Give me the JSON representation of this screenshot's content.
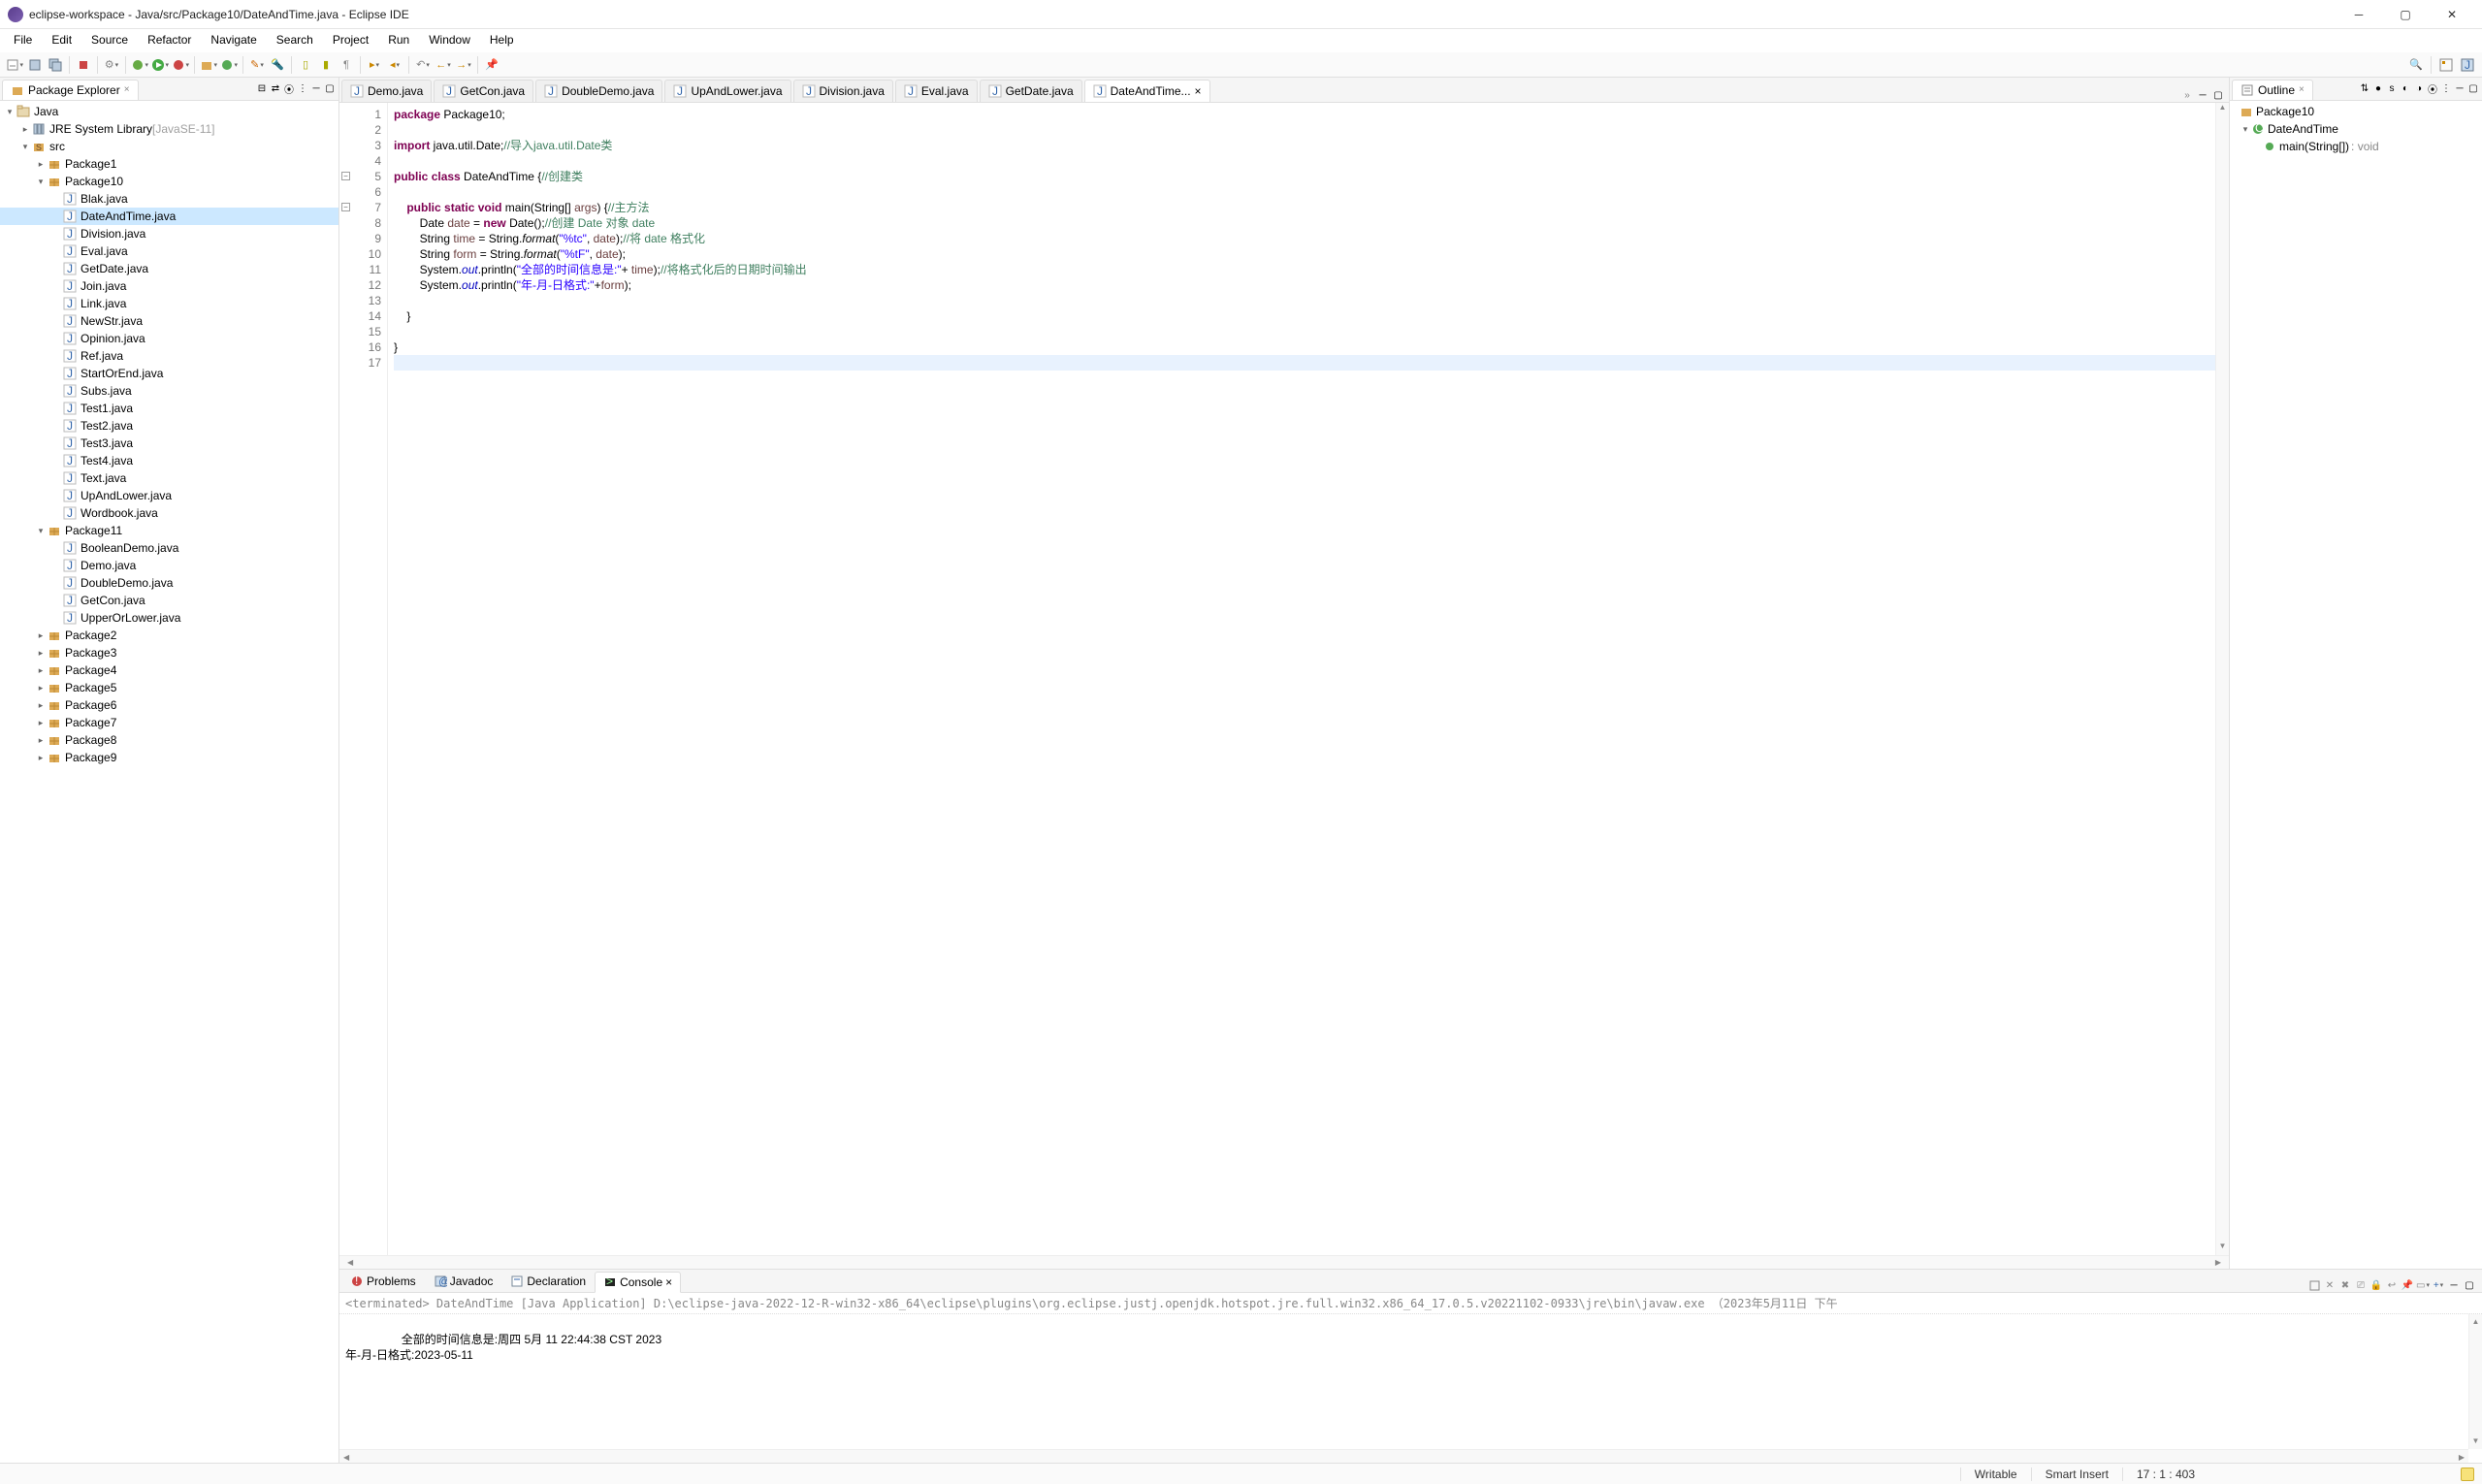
{
  "window": {
    "title": "eclipse-workspace - Java/src/Package10/DateAndTime.java - Eclipse IDE"
  },
  "menu": [
    "File",
    "Edit",
    "Source",
    "Refactor",
    "Navigate",
    "Search",
    "Project",
    "Run",
    "Window",
    "Help"
  ],
  "packageExplorer": {
    "title": "Package Explorer",
    "tree": {
      "project": "Java",
      "jre": {
        "label": "JRE System Library",
        "version": "[JavaSE-11]"
      },
      "src": "src",
      "packages": [
        {
          "name": "Package1",
          "expanded": false
        },
        {
          "name": "Package10",
          "expanded": true,
          "files": [
            "Blak.java",
            "DateAndTime.java",
            "Division.java",
            "Eval.java",
            "GetDate.java",
            "Join.java",
            "Link.java",
            "NewStr.java",
            "Opinion.java",
            "Ref.java",
            "StartOrEnd.java",
            "Subs.java",
            "Test1.java",
            "Test2.java",
            "Test3.java",
            "Test4.java",
            "Text.java",
            "UpAndLower.java",
            "Wordbook.java"
          ]
        },
        {
          "name": "Package11",
          "expanded": true,
          "files": [
            "BooleanDemo.java",
            "Demo.java",
            "DoubleDemo.java",
            "GetCon.java",
            "UpperOrLower.java"
          ]
        },
        {
          "name": "Package2",
          "expanded": false
        },
        {
          "name": "Package3",
          "expanded": false
        },
        {
          "name": "Package4",
          "expanded": false
        },
        {
          "name": "Package5",
          "expanded": false
        },
        {
          "name": "Package6",
          "expanded": false
        },
        {
          "name": "Package7",
          "expanded": false
        },
        {
          "name": "Package8",
          "expanded": false
        },
        {
          "name": "Package9",
          "expanded": false
        }
      ],
      "selected": "DateAndTime.java"
    }
  },
  "editor": {
    "tabs": [
      "Demo.java",
      "GetCon.java",
      "DoubleDemo.java",
      "UpAndLower.java",
      "Division.java",
      "Eval.java",
      "GetDate.java",
      "DateAndTime..."
    ],
    "activeTab": "DateAndTime...",
    "lines": [
      {
        "n": 1,
        "html": "<span class='kw'>package</span> Package10;"
      },
      {
        "n": 2,
        "html": ""
      },
      {
        "n": 3,
        "html": "<span class='kw'>import</span> java.util.Date;<span class='cm'>//导入java.util.Date类</span>"
      },
      {
        "n": 4,
        "html": ""
      },
      {
        "n": 5,
        "html": "<span class='kw'>public</span> <span class='kw'>class</span> DateAndTime {<span class='cm'>//创建类</span>"
      },
      {
        "n": 6,
        "html": ""
      },
      {
        "n": 7,
        "html": "    <span class='kw'>public</span> <span class='kw'>static</span> <span class='kw'>void</span> main(String[] <span class='arg'>args</span>) {<span class='cm'>//主方法</span>"
      },
      {
        "n": 8,
        "html": "        Date <span class='arg'>date</span> = <span class='kw'>new</span> Date();<span class='cm'>//创建 Date 对象 date</span>"
      },
      {
        "n": 9,
        "html": "        String <span class='arg'>time</span> = String.<span class='ital'>format</span>(<span class='str'>\"%tc\"</span>, <span class='arg'>date</span>);<span class='cm'>//将 date 格式化</span>"
      },
      {
        "n": 10,
        "html": "        String <span class='arg'>form</span> = String.<span class='ital'>format</span>(<span class='str'>\"%tF\"</span>, <span class='arg'>date</span>);"
      },
      {
        "n": 11,
        "html": "        System.<span class='fld ital'>out</span>.println(<span class='str'>\"全部的时间信息是:\"</span>+ <span class='arg'>time</span>);<span class='cm'>//将格式化后的日期时间输出</span>"
      },
      {
        "n": 12,
        "html": "        System.<span class='fld ital'>out</span>.println(<span class='str'>\"年-月-日格式:\"</span>+<span class='arg'>form</span>);"
      },
      {
        "n": 13,
        "html": ""
      },
      {
        "n": 14,
        "html": "    }"
      },
      {
        "n": 15,
        "html": ""
      },
      {
        "n": 16,
        "html": "}"
      },
      {
        "n": 17,
        "html": "",
        "highlight": true
      }
    ]
  },
  "outline": {
    "title": "Outline",
    "root": "Package10",
    "class": "DateAndTime",
    "method": {
      "sig": "main(String[])",
      "ret": ": void"
    }
  },
  "bottomTabs": {
    "items": [
      "Problems",
      "Javadoc",
      "Declaration",
      "Console"
    ],
    "active": "Console"
  },
  "console": {
    "terminated": "<terminated> DateAndTime [Java Application] D:\\eclipse-java-2022-12-R-win32-x86_64\\eclipse\\plugins\\org.eclipse.justj.openjdk.hotspot.jre.full.win32.x86_64_17.0.5.v20221102-0933\\jre\\bin\\javaw.exe （2023年5月11日 下午",
    "out": "全部的时间信息是:周四 5月 11 22:44:38 CST 2023\n年-月-日格式:2023-05-11"
  },
  "statusBar": {
    "writable": "Writable",
    "insert": "Smart Insert",
    "pos": "17 : 1 : 403"
  }
}
